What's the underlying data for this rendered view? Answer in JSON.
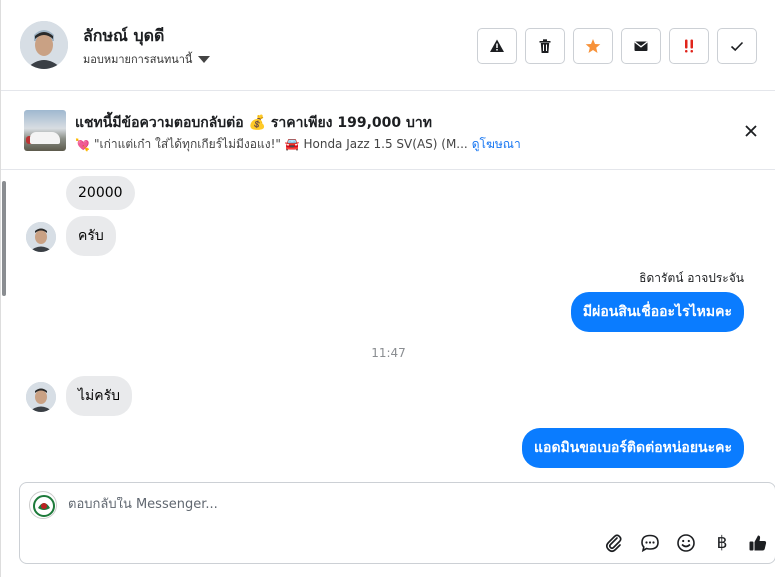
{
  "header": {
    "contact_name": "ลักษณ์ บุดดี",
    "assign_label": "มอบหมายการสนทนานี้",
    "actions": [
      "warning-icon",
      "trash-icon",
      "star-icon",
      "envelope-icon",
      "double-exclamation-icon",
      "check-icon"
    ],
    "colors": {
      "star": "#f7923a",
      "exclaim": "#e0241b"
    }
  },
  "banner": {
    "title": "แชทนี้มีข้อความตอบกลับต่อ 💰 ราคาเพียง 199,000 บาท",
    "subtitle_prefix": "💘",
    "subtitle": "\"เก่าแต่เก๋า ใส่ได้ทุกเกียร์ไม่มีงอแง!\" 🚘 Honda Jazz 1.5 SV(AS) (M...",
    "link": "ดูโฆษณา"
  },
  "messages": [
    {
      "side": "in",
      "text": "20000"
    },
    {
      "side": "in",
      "text": "ครับ",
      "avatar": true
    },
    {
      "side": "sender",
      "text": "ธิดารัตน์ อาจประจัน"
    },
    {
      "side": "out",
      "text": "มีผ่อนสินเชื่ออะไรไหมคะ"
    },
    {
      "side": "time",
      "text": "11:47"
    },
    {
      "side": "in",
      "text": "ไม่ครับ",
      "avatar": true
    },
    {
      "side": "out",
      "text": "แอดมินขอเบอร์ติดต่อหน่อยนะคะ"
    }
  ],
  "composer": {
    "placeholder": "ตอบกลับใน Messenger...",
    "tools": [
      "paperclip-icon",
      "chat-bubble-icon",
      "smiley-icon",
      "baht-icon",
      "thumbs-up-icon"
    ],
    "currency_symbol": "฿"
  },
  "colors": {
    "outgoing_bubble": "#0a7cff",
    "incoming_bubble": "#e9eaec",
    "link": "#1877f2"
  }
}
